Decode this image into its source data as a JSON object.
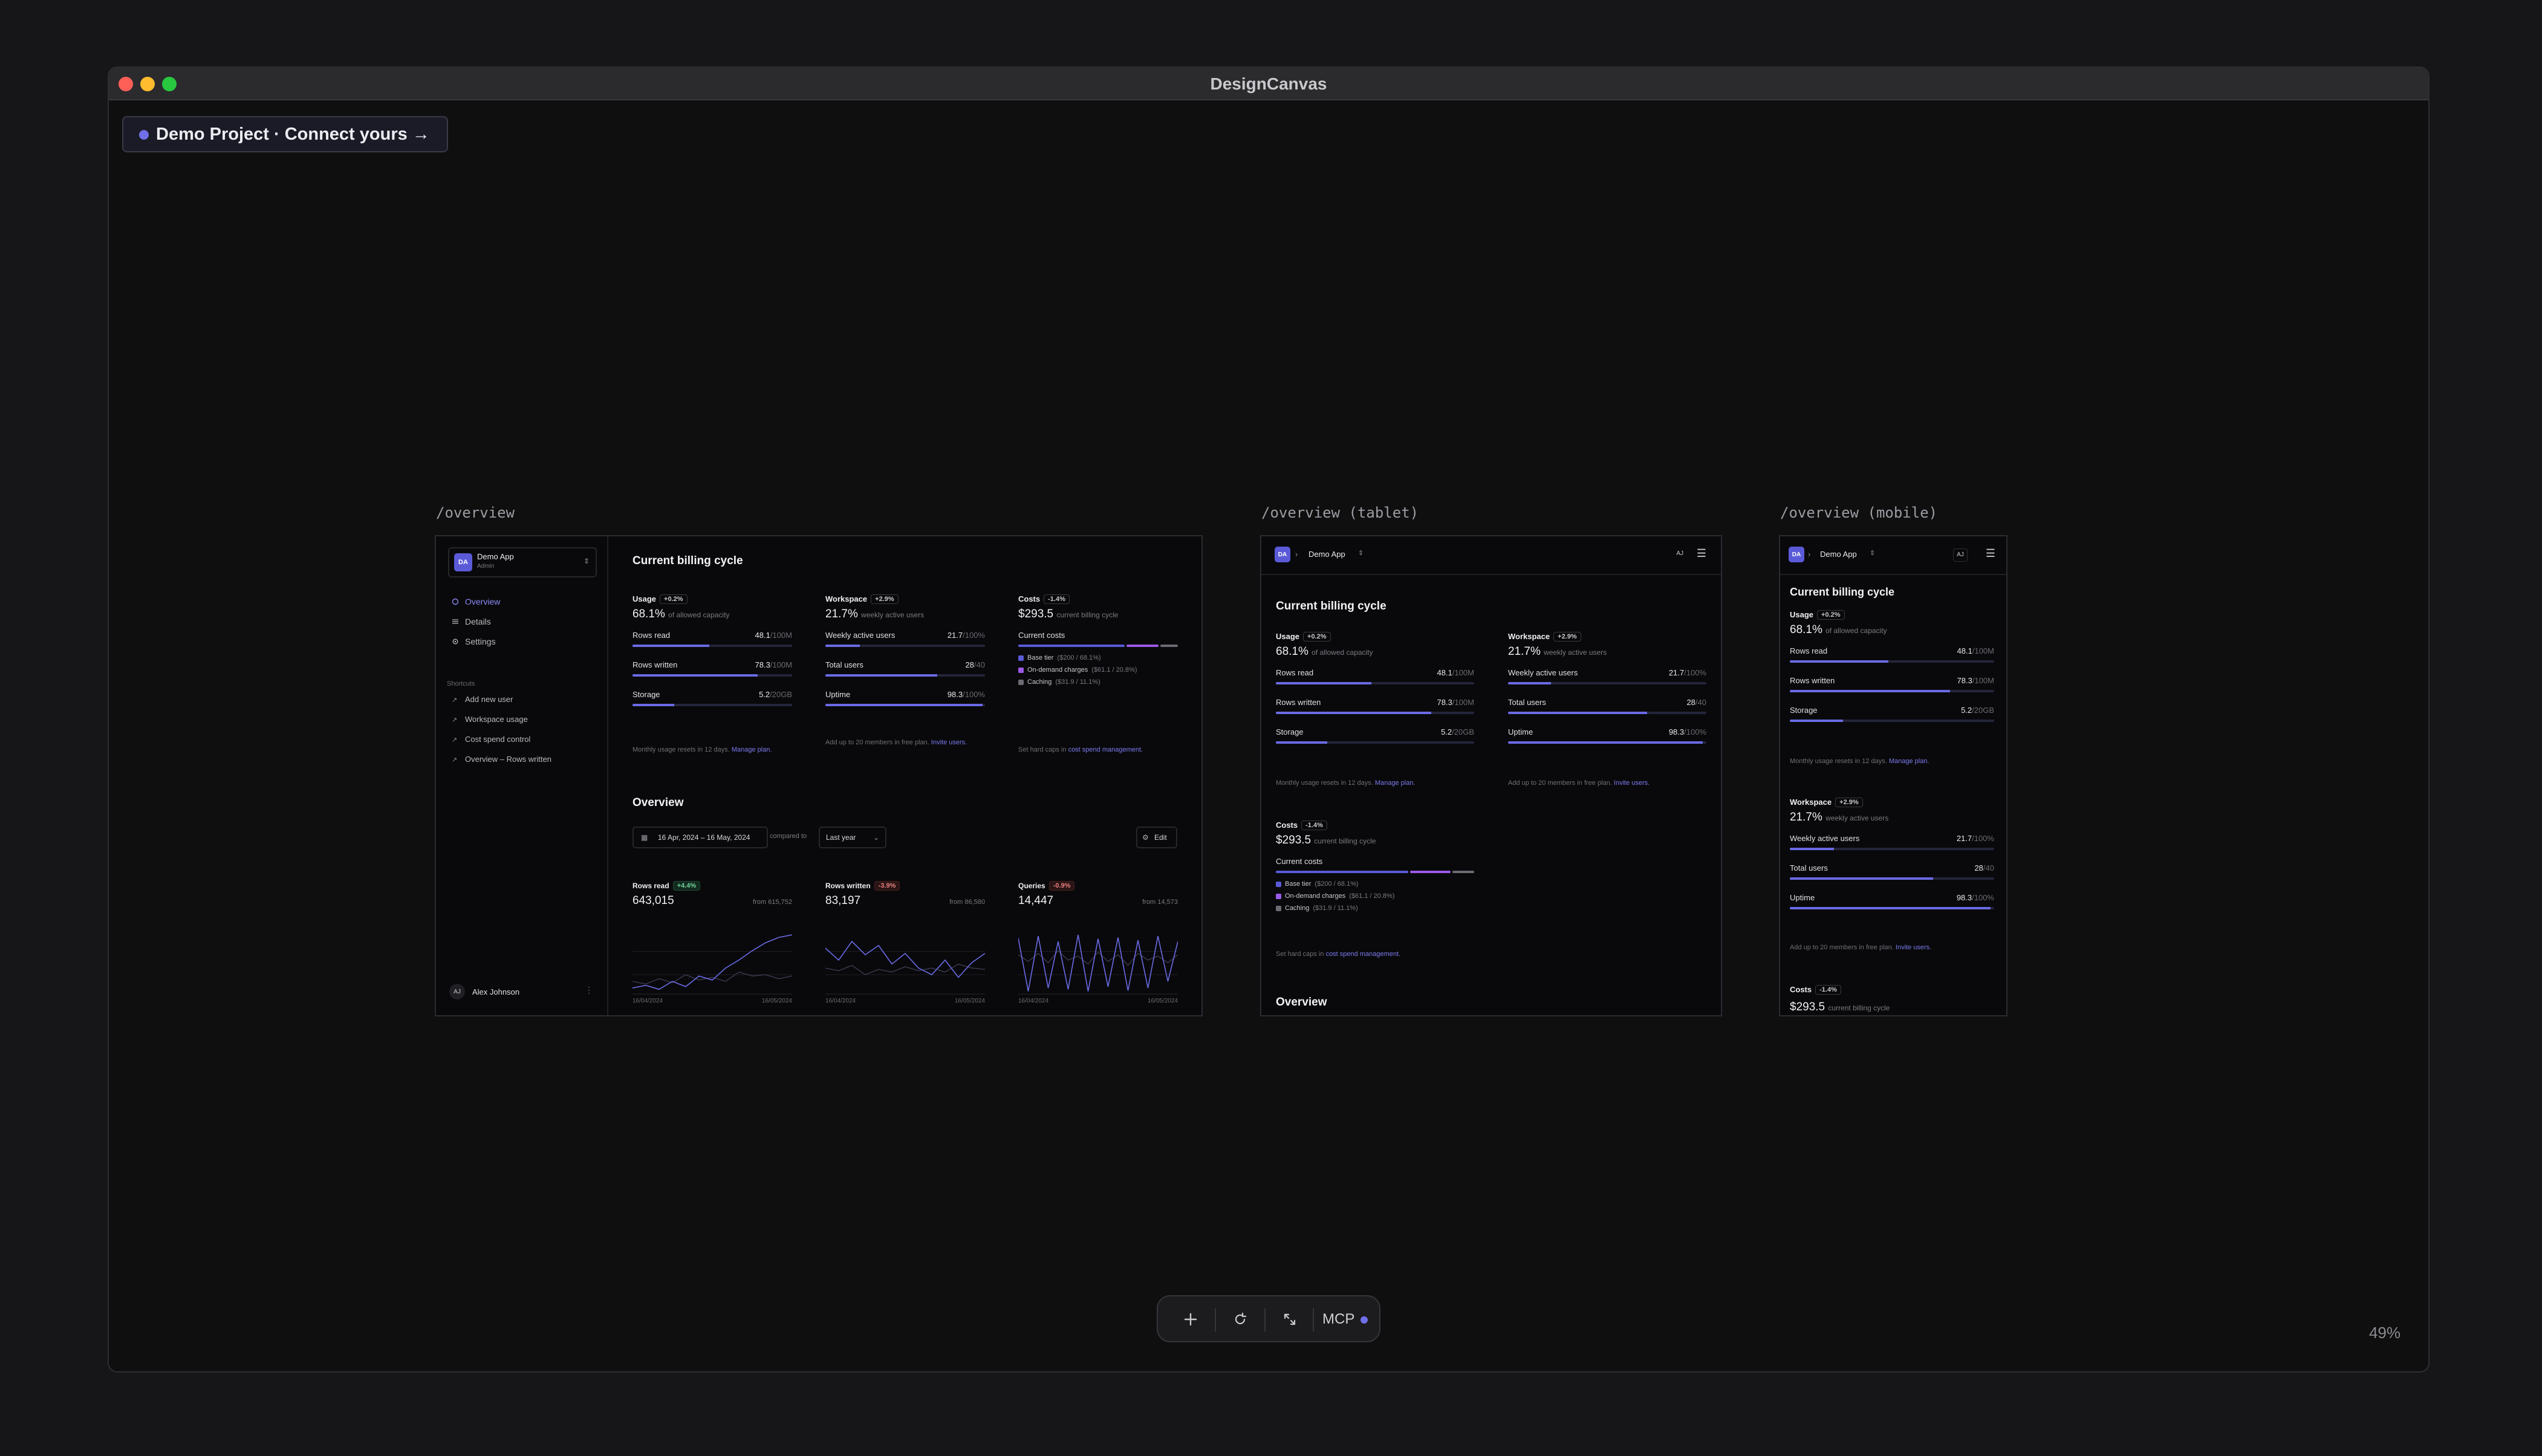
{
  "window": {
    "title": "DesignCanvas"
  },
  "project": {
    "label": "Demo Project · Connect yours →"
  },
  "zoom": "49%",
  "toolbar": {
    "mcp_label": "MCP"
  },
  "frames": {
    "desktop_label": "/overview",
    "tablet_label": "/overview (tablet)",
    "mobile_label": "/overview (mobile)"
  },
  "app": {
    "name": "Demo App",
    "role": "Admin",
    "initials": "DA",
    "user_initials": "AJ",
    "user_name": "Alex Johnson",
    "nav": [
      "Overview",
      "Details",
      "Settings"
    ],
    "shortcuts_title": "Shortcuts",
    "shortcuts": [
      "Add new user",
      "Workspace usage",
      "Cost spend control",
      "Overview – Rows written"
    ]
  },
  "billing": {
    "title": "Current billing cycle",
    "usage": {
      "label": "Usage",
      "badge": "+0.2%",
      "value": "68.1%",
      "sub": "of allowed capacity",
      "rows": [
        {
          "label": "Rows read",
          "value": "48.1",
          "unit": "/100M",
          "fill": 0.481
        },
        {
          "label": "Rows written",
          "value": "78.3",
          "unit": "/100M",
          "fill": 0.783
        },
        {
          "label": "Storage",
          "value": "5.2",
          "unit": "/20GB",
          "fill": 0.26
        }
      ],
      "note": "Monthly usage resets in 12 days.",
      "note_link": "Manage plan."
    },
    "workspace": {
      "label": "Workspace",
      "badge": "+2.9%",
      "value": "21.7%",
      "sub": "weekly active users",
      "rows": [
        {
          "label": "Weekly active users",
          "value": "21.7",
          "unit": "/100%",
          "fill": 0.217
        },
        {
          "label": "Total users",
          "value": "28",
          "unit": "/40",
          "fill": 0.7
        },
        {
          "label": "Uptime",
          "value": "98.3",
          "unit": "/100%",
          "fill": 0.983
        }
      ],
      "note": "Add up to 20 members in free plan.",
      "note_link": "Invite users."
    },
    "costs": {
      "label": "Costs",
      "badge": "-1.4%",
      "value": "$293.5",
      "sub": "current billing cycle",
      "current_label": "Current costs",
      "legend": [
        {
          "label": "Base tier",
          "sub": "($200 / 68.1%)",
          "color": "#5a5ad8",
          "share": 0.681
        },
        {
          "label": "On-demand charges",
          "sub": "($61.1 / 20.8%)",
          "color": "#9b59e8",
          "share": 0.208
        },
        {
          "label": "Caching",
          "sub": "($31.9 / 11.1%)",
          "color": "#6b6b74",
          "share": 0.111
        }
      ],
      "note": "Set hard caps in",
      "note_link": "cost spend management."
    }
  },
  "overview": {
    "title": "Overview",
    "date_range": "16 Apr, 2024 – 16 May, 2024",
    "compared_to": "compared to",
    "period": "Last year",
    "edit_label": "Edit",
    "cards": [
      {
        "label": "Rows read",
        "badge": "+4.4%",
        "badge_type": "up",
        "value": "643,015",
        "from": "from 615,752",
        "start": "16/04/2024",
        "end": "16/05/2024"
      },
      {
        "label": "Rows written",
        "badge": "-3.9%",
        "badge_type": "down",
        "value": "83,197",
        "from": "from 86,580",
        "start": "16/04/2024",
        "end": "16/05/2024"
      },
      {
        "label": "Queries",
        "badge": "-0.9%",
        "badge_type": "down",
        "value": "14,447",
        "from": "from 14,573",
        "start": "16/04/2024",
        "end": "16/05/2024"
      }
    ]
  },
  "colors": {
    "accent": "#6a6ae6",
    "bg": "#09090b",
    "window": "#0f0f10"
  }
}
